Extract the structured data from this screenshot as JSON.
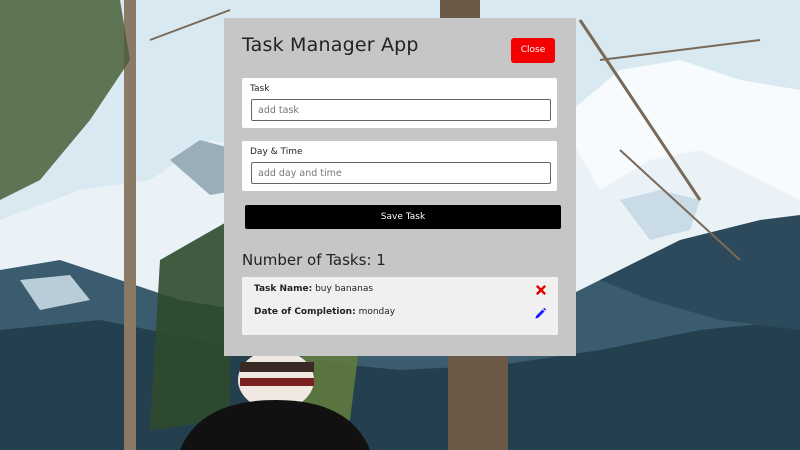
{
  "app": {
    "title": "Task Manager App",
    "close_label": "Close"
  },
  "form": {
    "task": {
      "label": "Task",
      "placeholder": "add task",
      "value": ""
    },
    "day_time": {
      "label": "Day & Time",
      "placeholder": "add day and time",
      "value": ""
    },
    "save_label": "Save Task"
  },
  "tasks": {
    "heading": "Number of Tasks: 1",
    "items": [
      {
        "name_label": "Task Name:",
        "name_value": "buy bananas",
        "date_label": "Date of Completion:",
        "date_value": "monday"
      }
    ]
  },
  "icons": {
    "delete": "close-icon",
    "edit": "pencil-icon"
  },
  "colors": {
    "close_button": "#f40000",
    "save_button": "#000000",
    "panel": "#c6c6c6",
    "delete_icon": "#e00000",
    "edit_icon": "#1a1aff"
  }
}
